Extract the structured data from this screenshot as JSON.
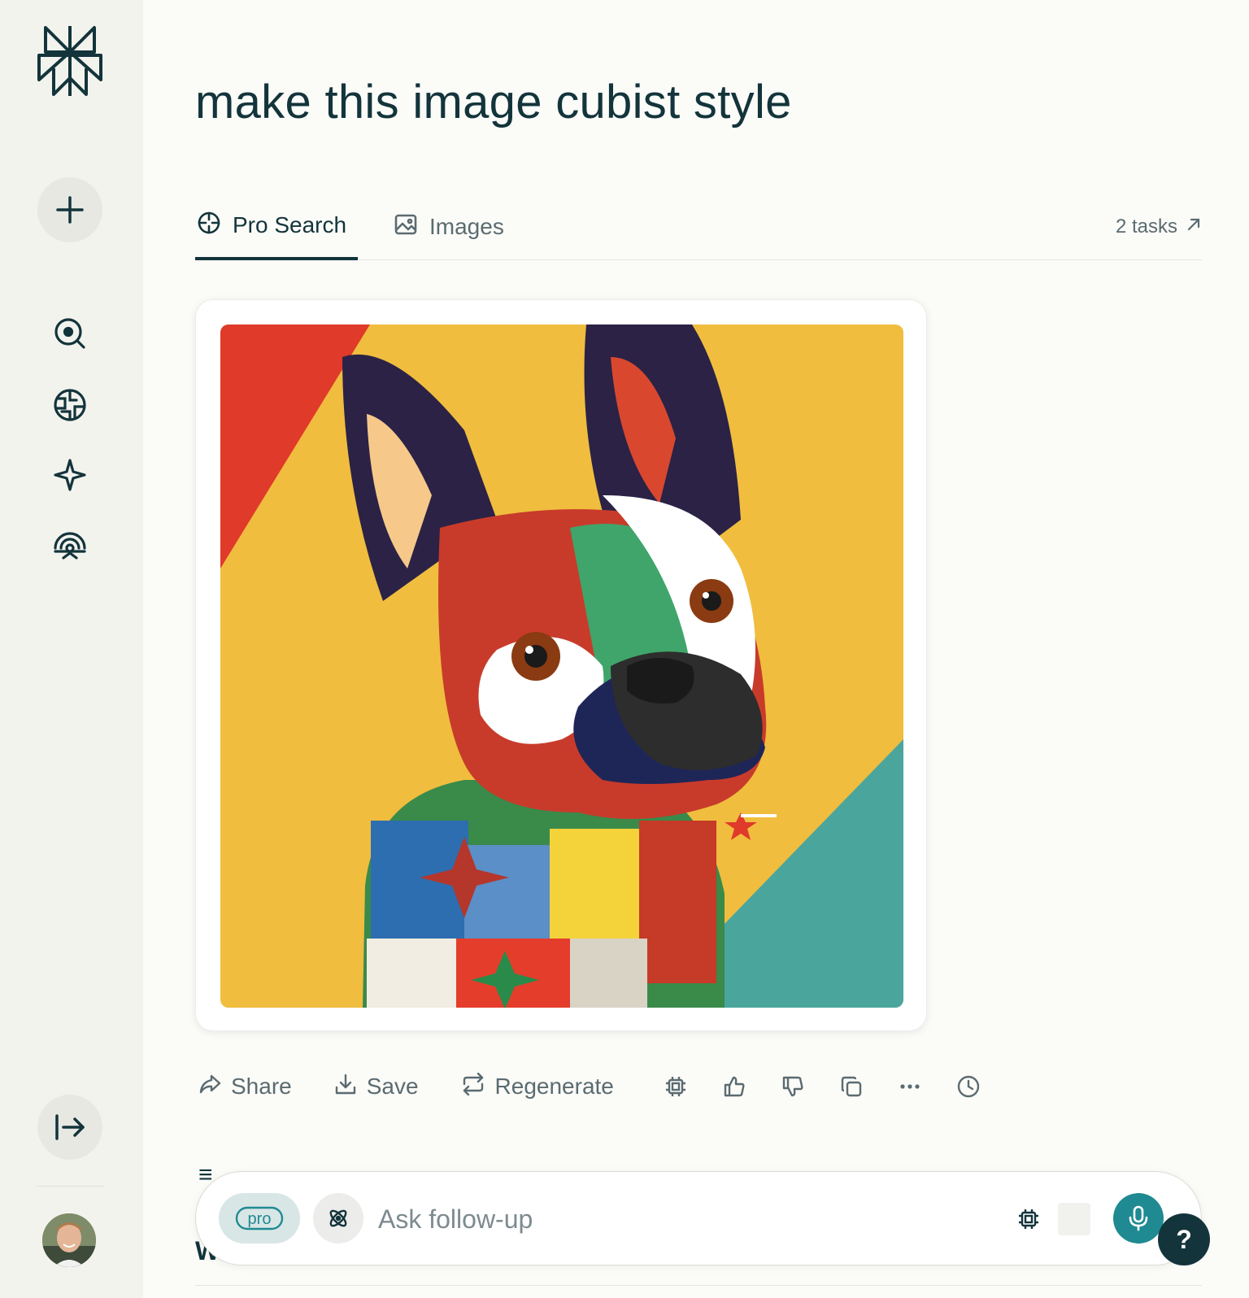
{
  "page": {
    "title": "make this image cubist style"
  },
  "tabs": {
    "pro_search": "Pro Search",
    "images": "Images",
    "tasks": "2 tasks"
  },
  "image": {
    "description_icon": "generated-image",
    "colors": {
      "red": "#e03a2a",
      "yellow": "#f0bd3e",
      "teal": "#4aa69d",
      "navy": "#1e2658"
    }
  },
  "actions": {
    "share": "Share",
    "save": "Save",
    "regenerate": "Regenerate"
  },
  "partial": {
    "line1": "≡",
    "line2": "W"
  },
  "followup": {
    "pro_label": "pro",
    "placeholder": "Ask follow-up"
  },
  "help": "?",
  "theme": {
    "accent": "#1f8a92",
    "text": "#13343b",
    "sidebar": "#f3f3ee"
  }
}
